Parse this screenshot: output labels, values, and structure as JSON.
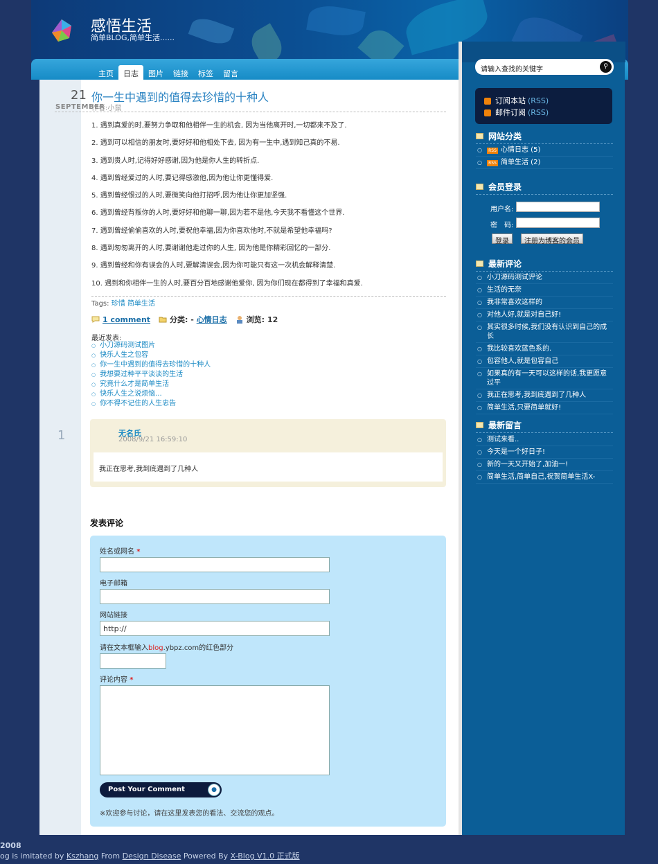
{
  "site": {
    "title": "感悟生活",
    "subtitle": "简单BLOG,简单生活......"
  },
  "nav": [
    {
      "label": "主页",
      "active": false
    },
    {
      "label": "日志",
      "active": true
    },
    {
      "label": "图片",
      "active": false
    },
    {
      "label": "链接",
      "active": false
    },
    {
      "label": "标签",
      "active": false
    },
    {
      "label": "留言",
      "active": false
    }
  ],
  "post": {
    "day": "21",
    "month": "SEPTEMBER",
    "title": "你一生中遇到的值得去珍惜的十种人",
    "author": "作者:小鼠",
    "paragraphs": [
      "1. 遇到真爱的时,要努力争取和他相伴一生的机会, 因为当他离开时,一切都来不及了.",
      "2. 遇到可以相信的朋友时,要好好和他相处下去, 因为有一生中,遇到知己真的不易.",
      "3. 遇到贵人时,记得好好感谢,因为他是你人生的转折点.",
      "4. 遇到曾经爱过的人时,要记得感激他,因为他让你更懂得爱.",
      "5. 遇到曾经恨过的人时,要微笑向他打招呼,因为他让你更加坚强.",
      "6. 遇到曾经背叛你的人时,要好好和他聊一聊,因为若不是他,今天我不看懂这个世界.",
      "7. 遇到曾经偷偷喜欢的人时,要祝他幸福,因为你喜欢他时,不就是希望他幸福吗?",
      "8. 遇到匆匆离开的人时,要谢谢他走过你的人生, 因为他是你精彩回忆的一部分.",
      "9. 遇到曾经和你有误会的人时,要解清误会,因为你可能只有这一次机会解释清楚.",
      "10. 遇到和你相伴一生的人时,要百分百地感谢他爱你, 因为你们现在都得到了幸福和真爱."
    ],
    "tags_label": "Tags:",
    "tags": [
      "珍惜",
      "简单生活"
    ],
    "comment_link": "1 comment",
    "category_label": "分类: -",
    "category": "心情日志",
    "views_label": "浏览:",
    "views": "12",
    "recent_label": "最近发表:",
    "recent": [
      "小刀源码测试图片",
      "快乐人生之包容",
      "你一生中遇到的值得去珍惜的十种人",
      "我想要过种平平淡淡的生活",
      "究竟什么才是简单生活",
      "快乐人生之说烦恼...",
      "你不得不记住的人生忠告"
    ]
  },
  "comments": [
    {
      "number": "1",
      "author": "无名氏",
      "date": "2008/9/21 16:59:10",
      "text": "我正在思考,我到底遇到了几种人"
    }
  ],
  "comment_form": {
    "heading": "发表评论",
    "name_label": "姓名或网名",
    "email_label": "电子邮箱",
    "url_label": "网站链接",
    "url_value": "http://",
    "code_hint_prefix": "请在文本框输入",
    "code_hint_red": "blog",
    "code_hint_suffix": ".ybpz.com的红色部分",
    "content_label": "评论内容",
    "required_mark": "*",
    "submit_label": "Post Your Comment",
    "note": "※欢迎参与讨论，请在这里发表您的看法、交流您的观点。"
  },
  "sidebar": {
    "search_placeholder": "请输入查找的关键字",
    "rss": [
      {
        "label": "订阅本站",
        "tag": "(RSS)"
      },
      {
        "label": "邮件订阅",
        "tag": "(RSS)"
      }
    ],
    "categories_title": "网站分类",
    "categories": [
      {
        "badge": "RSS",
        "label": "心情日志 (5)"
      },
      {
        "badge": "RSS",
        "label": "简单生活 (2)"
      }
    ],
    "login_title": "会员登录",
    "login_user_label": "用户名:",
    "login_pass_label": "密　码:",
    "login_button": "登录",
    "register_button": "注册为博客的会员",
    "latest_comments_title": "最新评论",
    "latest_comments": [
      "小刀源码测试评论",
      "生活的无奈",
      "我非常喜欢这样的",
      "对他人好,就是对自己好!",
      "其实很多时候,我们没有认识到自己的成长",
      "我比较喜欢蓝色系的.",
      "包容他人,就是包容自己",
      "如果真的有一天可以这样的话,我更愿意过平",
      "我正在思考,我到底遇到了几种人",
      "简单生活,只要简单就好!"
    ],
    "latest_messages_title": "最新留言",
    "latest_messages": [
      "测试来看..",
      "今天是一个好日子!",
      "新的一天又开始了,加油一!",
      "简单生活,简单自己,祝贺简单生活X-"
    ]
  },
  "footer": {
    "year": "2008",
    "line2_prefix": "og is imitated by",
    "author_link": "Kszhang",
    "from_text": "From",
    "design_link": "Design Disease",
    "powered_text": "Powered By",
    "powered_link": "X-Blog V1.0 正式版"
  },
  "colors": {
    "page_bg": "#1f3566",
    "accent": "#1b8ac4",
    "sidebar_bg": "#0b5e97",
    "comment_box_bg": "#f5f0dc",
    "form_bg": "#bfe6fb"
  }
}
